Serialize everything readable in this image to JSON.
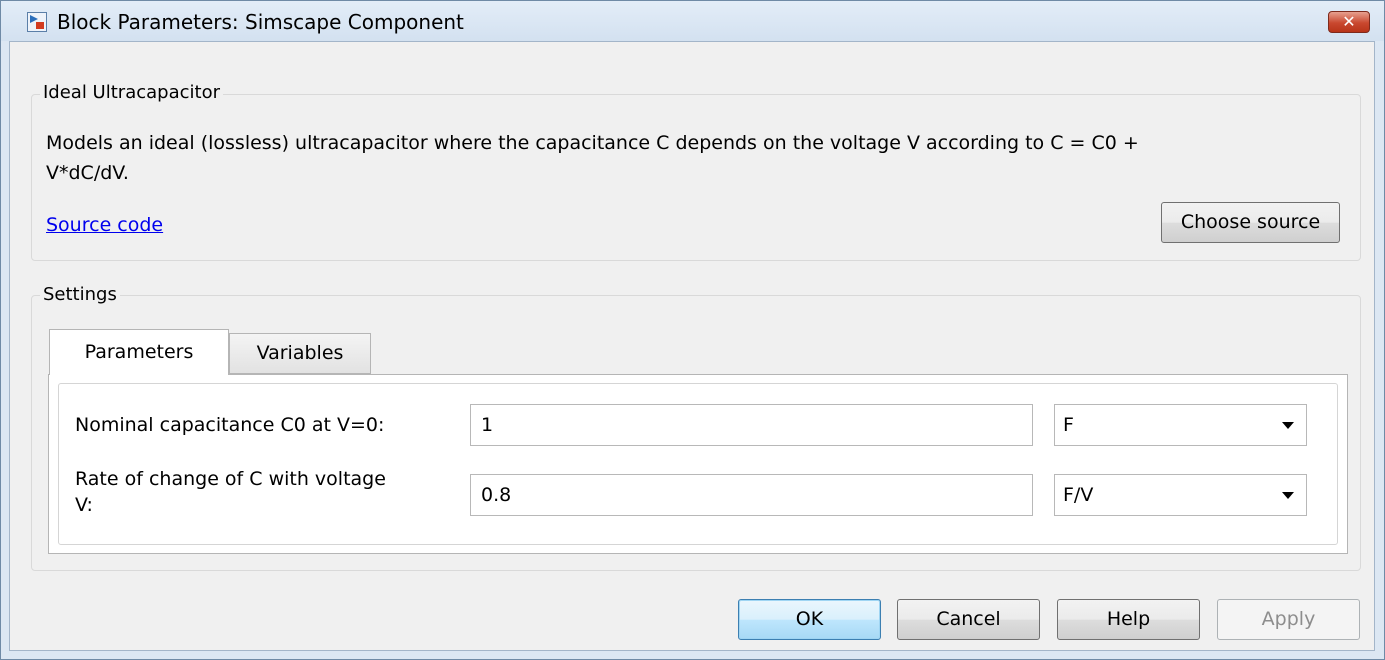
{
  "window": {
    "title": "Block Parameters: Simscape Component",
    "close_label": "✕"
  },
  "component": {
    "legend": "Ideal Ultracapacitor",
    "description_line1": "Models an ideal (lossless) ultracapacitor where the capacitance C depends on the voltage V according to C = C0 +",
    "description_line2": "V*dC/dV.",
    "source_link": "Source code",
    "choose_source_label": "Choose source"
  },
  "settings": {
    "legend": "Settings",
    "tabs": [
      {
        "label": "Parameters",
        "active": true
      },
      {
        "label": "Variables",
        "active": false
      }
    ],
    "params": [
      {
        "label_line1": "Nominal capacitance C0 at V=0:",
        "label_line2": "",
        "value": "1",
        "unit": "F"
      },
      {
        "label_line1": "Rate of change of C with voltage",
        "label_line2": "V:",
        "value": "0.8",
        "unit": "F/V"
      }
    ]
  },
  "buttons": {
    "ok": "OK",
    "cancel": "Cancel",
    "help": "Help",
    "apply": "Apply"
  },
  "colors": {
    "link": "#0000ee",
    "default_button_border": "#3c7fb1",
    "close_button": "#c9482f"
  },
  "icons": {
    "app": "simulink-block-icon",
    "close": "close-icon",
    "dropdown": "chevron-down-icon"
  }
}
